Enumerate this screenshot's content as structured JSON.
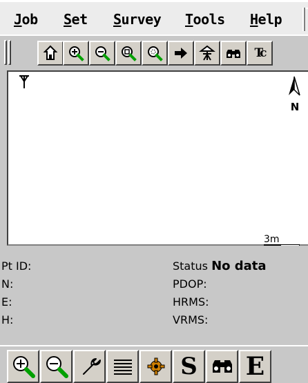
{
  "menu": {
    "items": [
      {
        "label": "Job",
        "accel": "J",
        "rest": "ob"
      },
      {
        "label": "Set",
        "accel": "S",
        "rest": "et"
      },
      {
        "label": "Survey",
        "accel": "S",
        "rest": "urvey"
      },
      {
        "label": "Tools",
        "accel": "T",
        "rest": "ools"
      },
      {
        "label": "Help",
        "accel": "H",
        "rest": "elp"
      }
    ]
  },
  "toolbar": {
    "buttons": [
      {
        "name": "home-icon"
      },
      {
        "name": "zoom-in-icon"
      },
      {
        "name": "zoom-out-icon"
      },
      {
        "name": "zoom-window-icon"
      },
      {
        "name": "zoom-extents-icon"
      },
      {
        "name": "arrow-right-icon"
      },
      {
        "name": "station-setup-icon"
      },
      {
        "name": "binoculars-icon"
      },
      {
        "name": "tc-label",
        "text": "Tc"
      }
    ]
  },
  "map": {
    "north_label": "N",
    "scale_label": "3m"
  },
  "status": {
    "pt_id_label": "Pt ID:",
    "n_label": "N:",
    "e_label": "E:",
    "h_label": "H:",
    "status_label": "Status",
    "status_value": "No data",
    "pdop_label": "PDOP:",
    "hrms_label": "HRMS:",
    "vrms_label": "VRMS:"
  },
  "bottombar": {
    "s_label": "S",
    "e_label": "E"
  },
  "colors": {
    "magnifier_handle": "#00a000",
    "gear": "#d08000"
  }
}
